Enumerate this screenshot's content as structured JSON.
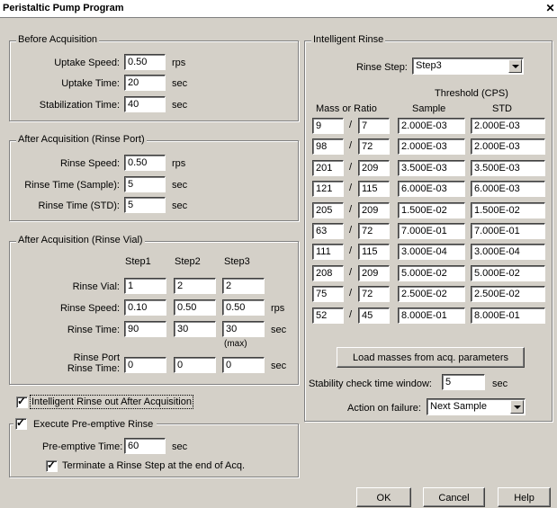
{
  "window": {
    "title": "Peristaltic Pump Program",
    "close_icon": "close-icon"
  },
  "before": {
    "title": "Before Acquisition",
    "rows": [
      {
        "label": "Uptake Speed:",
        "value": "0.50",
        "unit": "rps"
      },
      {
        "label": "Uptake Time:",
        "value": "20",
        "unit": "sec"
      },
      {
        "label": "Stabilization Time:",
        "value": "40",
        "unit": "sec"
      }
    ]
  },
  "after_port": {
    "title": "After Acquisition (Rinse Port)",
    "rows": [
      {
        "label": "Rinse Speed:",
        "value": "0.50",
        "unit": "rps"
      },
      {
        "label": "Rinse Time (Sample):",
        "value": "5",
        "unit": "sec"
      },
      {
        "label": "Rinse Time (STD):",
        "value": "5",
        "unit": "sec"
      }
    ]
  },
  "after_vial": {
    "title": "After Acquisition (Rinse Vial)",
    "headers": [
      "Step1",
      "Step2",
      "Step3"
    ],
    "rows": [
      {
        "label": "Rinse Vial:",
        "values": [
          "1",
          "2",
          "2"
        ],
        "unit": ""
      },
      {
        "label": "Rinse Speed:",
        "values": [
          "0.10",
          "0.50",
          "0.50"
        ],
        "unit": "rps"
      },
      {
        "label": "Rinse Time:",
        "values": [
          "90",
          "30",
          "30"
        ],
        "unit": "sec"
      },
      {
        "label_line1": "Rinse Port",
        "label_line2": "Rinse Time:",
        "values": [
          "0",
          "0",
          "0"
        ],
        "unit": "sec"
      }
    ],
    "max_note": "(max)"
  },
  "intelligent_rinse_check": {
    "label": "Intelligent Rinse out After Acquisition",
    "checked": true
  },
  "preemptive": {
    "title": "Execute Pre-emptive Rinse",
    "checked": true,
    "time_label": "Pre-emptive Time:",
    "time_value": "60",
    "time_unit": "sec",
    "terminate_label": "Terminate a Rinse Step at the end of Acq.",
    "terminate_checked": true
  },
  "intelligent": {
    "title": "Intelligent Rinse",
    "step_label": "Rinse Step:",
    "step_value": "Step3",
    "threshold_header": "Threshold (CPS)",
    "mass_header": "Mass or Ratio",
    "sample_header": "Sample",
    "std_header": "STD",
    "slash": "/",
    "rows": [
      {
        "m1": "9",
        "m2": "7",
        "sample": "2.000E-03",
        "std": "2.000E-03"
      },
      {
        "m1": "98",
        "m2": "72",
        "sample": "2.000E-03",
        "std": "2.000E-03"
      },
      {
        "m1": "201",
        "m2": "209",
        "sample": "3.500E-03",
        "std": "3.500E-03"
      },
      {
        "m1": "121",
        "m2": "115",
        "sample": "6.000E-03",
        "std": "6.000E-03"
      },
      {
        "m1": "205",
        "m2": "209",
        "sample": "1.500E-02",
        "std": "1.500E-02"
      },
      {
        "m1": "63",
        "m2": "72",
        "sample": "7.000E-01",
        "std": "7.000E-01"
      },
      {
        "m1": "111",
        "m2": "115",
        "sample": "3.000E-04",
        "std": "3.000E-04"
      },
      {
        "m1": "208",
        "m2": "209",
        "sample": "5.000E-02",
        "std": "5.000E-02"
      },
      {
        "m1": "75",
        "m2": "72",
        "sample": "2.500E-02",
        "std": "2.500E-02"
      },
      {
        "m1": "52",
        "m2": "45",
        "sample": "8.000E-01",
        "std": "8.000E-01"
      }
    ],
    "load_button": "Load masses from acq. parameters",
    "stability_label": "Stability check time window:",
    "stability_value": "5",
    "stability_unit": "sec",
    "action_label": "Action on failure:",
    "action_value": "Next Sample"
  },
  "buttons": {
    "ok": "OK",
    "cancel": "Cancel",
    "help": "Help"
  }
}
